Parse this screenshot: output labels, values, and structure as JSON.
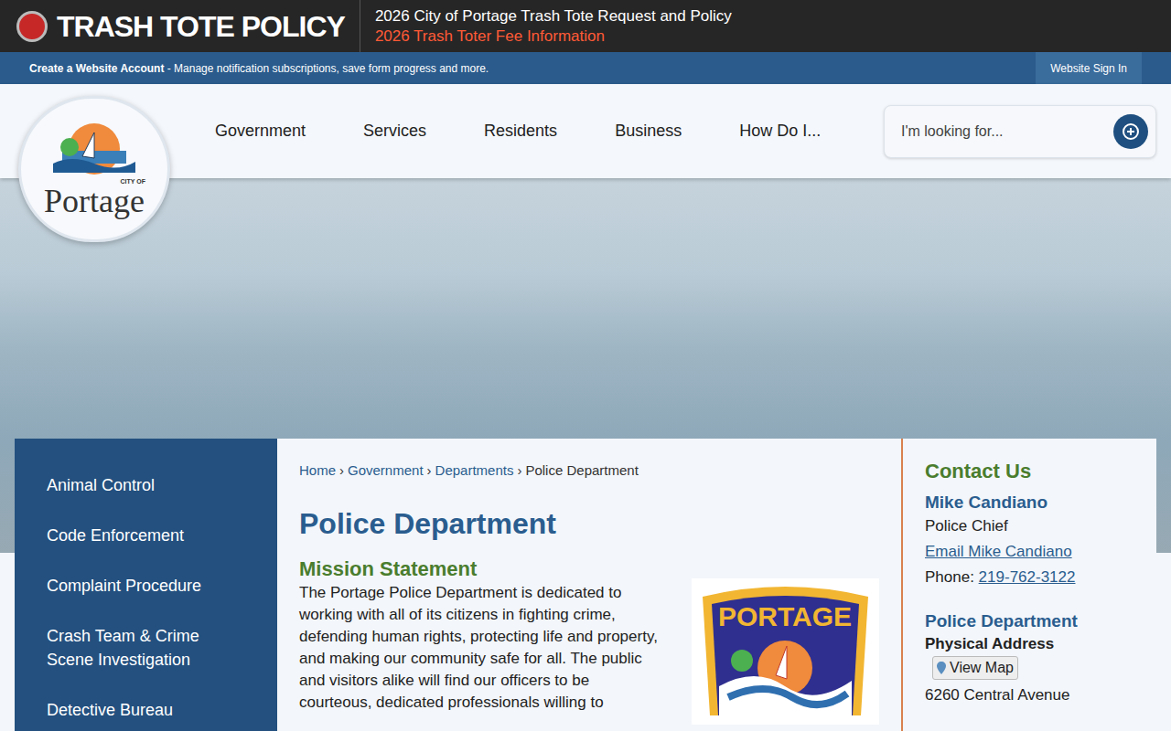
{
  "alert_bar": {
    "title": "TRASH TOTE POLICY",
    "links": [
      "2026 City of Portage Trash Tote Request and Policy",
      "2026 Trash Toter Fee Information"
    ]
  },
  "account_bar": {
    "bold": "Create a Website Account",
    "text": " - Manage notification subscriptions, save form progress and more.",
    "sign_in": "Website Sign In"
  },
  "logo": {
    "small": "CITY OF",
    "name": "Portage"
  },
  "nav": {
    "items": [
      "Government",
      "Services",
      "Residents",
      "Business",
      "How Do I..."
    ]
  },
  "search": {
    "placeholder": "I'm looking for..."
  },
  "sidebar": {
    "items": [
      "Animal Control",
      "Code Enforcement",
      "Complaint Procedure",
      "Crash Team & Crime Scene Investigation",
      "Detective Bureau"
    ]
  },
  "breadcrumb": [
    "Home",
    "Government",
    "Departments",
    "Police Department"
  ],
  "breadcrumb_separator": "›",
  "page": {
    "title": "Police Department",
    "subtitle": "Mission Statement",
    "paragraph": "The Portage Police Department is dedicated to working with all of its citizens in fighting crime, defending human rights, protecting life and property, and making our community safe for all. The public and visitors alike will find our officers to be courteous, dedicated professionals willing to",
    "badge_text": "PORTAGE"
  },
  "contact": {
    "heading": "Contact Us",
    "name": "Mike Candiano",
    "role": "Police Chief",
    "email": "Email Mike Candiano",
    "phone_label": "Phone: ",
    "phone": "219-762-3122",
    "dept": "Police Department",
    "address_label": "Physical Address",
    "map_button": "View Map",
    "street": "6260 Central Avenue"
  }
}
